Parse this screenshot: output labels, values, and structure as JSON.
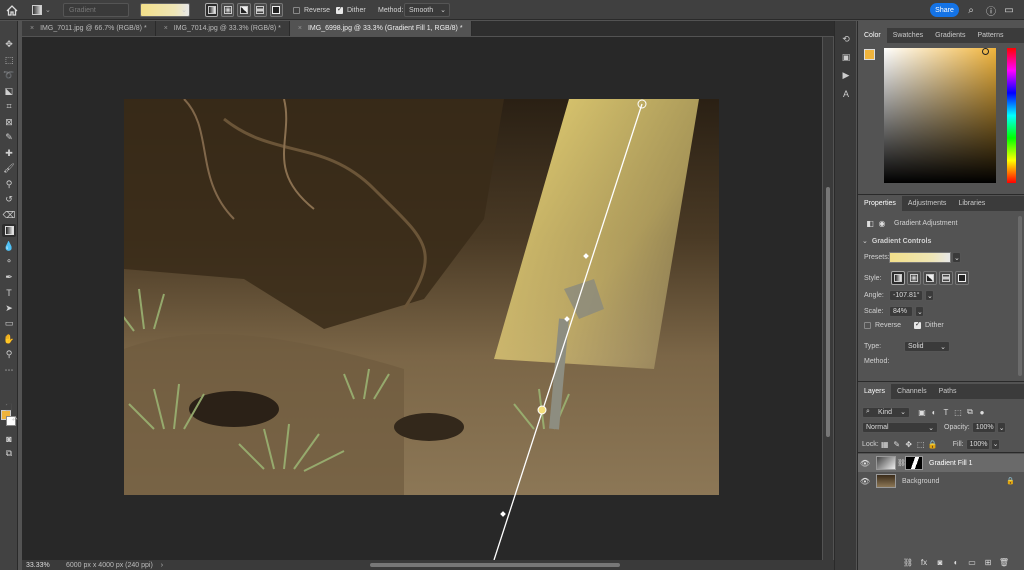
{
  "options_bar": {
    "gradient_mode": "Gradient",
    "reverse_label": "Reverse",
    "reverse_checked": false,
    "dither_label": "Dither",
    "dither_checked": true,
    "method_label": "Method:",
    "method_value": "Smooth",
    "share_label": "Share"
  },
  "tabs": [
    {
      "label": "IMG_7011.jpg @ 66.7% (RGB/8) *",
      "active": false
    },
    {
      "label": "IMG_7014.jpg @ 33.3% (RGB/8) *",
      "active": false
    },
    {
      "label": "IMG_6998.jpg @ 33.3% (Gradient Fill 1, RGB/8) *",
      "active": true
    }
  ],
  "status": {
    "zoom": "33.33%",
    "doc_info": "6000 px x 4000 px (240 ppi)"
  },
  "color_panel": {
    "tabs": [
      "Color",
      "Swatches",
      "Gradients",
      "Patterns"
    ],
    "foreground": "#f0b43c",
    "background": "#ffffff"
  },
  "properties_panel": {
    "tabs": [
      "Properties",
      "Adjustments",
      "Libraries"
    ],
    "type_label": "Gradient Adjustment",
    "section_label": "Gradient Controls",
    "presets_label": "Presets:",
    "style_label": "Style:",
    "angle_label": "Angle:",
    "angle_value": "-107.81°",
    "scale_label": "Scale:",
    "scale_value": "84%",
    "reverse_label": "Reverse",
    "reverse_checked": false,
    "dither_label": "Dither",
    "dither_checked": true,
    "type_row_label": "Type:",
    "type_value": "Solid",
    "method_label": "Method:"
  },
  "layers_panel": {
    "tabs": [
      "Layers",
      "Channels",
      "Paths"
    ],
    "filter_label": "Kind",
    "blend_mode": "Normal",
    "opacity_label": "Opacity:",
    "opacity_value": "100%",
    "lock_label": "Lock:",
    "fill_label": "Fill:",
    "fill_value": "100%",
    "layers": [
      {
        "name": "Gradient Fill 1",
        "selected": true
      },
      {
        "name": "Background",
        "selected": false
      }
    ]
  },
  "colors": {
    "accent": "#1473e6",
    "gradient_yellow": "#f5df7a"
  }
}
